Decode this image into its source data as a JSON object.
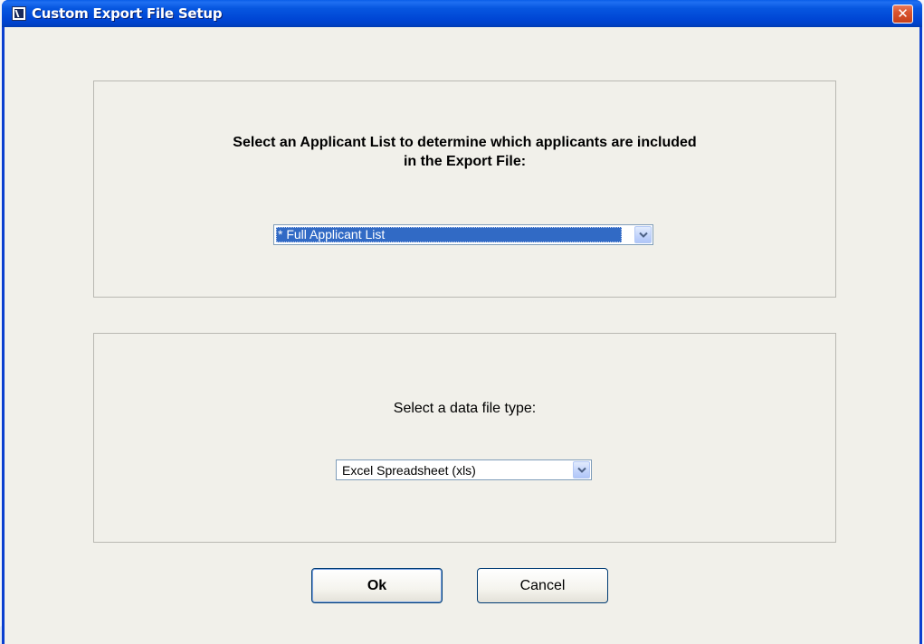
{
  "window": {
    "title": "Custom Export File Setup",
    "close_glyph": "✕"
  },
  "applicant_section": {
    "prompt_line1": "Select an Applicant List to determine which applicants are included",
    "prompt_line2": "in the Export File:",
    "selected_value": "* Full Applicant List"
  },
  "filetype_section": {
    "prompt": "Select a data file type:",
    "selected_value": "Excel Spreadsheet (xls)"
  },
  "buttons": {
    "ok_label": "Ok",
    "cancel_label": "Cancel"
  },
  "colors": {
    "titlebar": "#0046d5",
    "selection": "#316ac5",
    "client_bg": "#f1f0ea"
  },
  "icons": {
    "title_icon": "app-icon",
    "close_icon": "close-icon",
    "dropdown_icon": "chevron-down-icon"
  }
}
